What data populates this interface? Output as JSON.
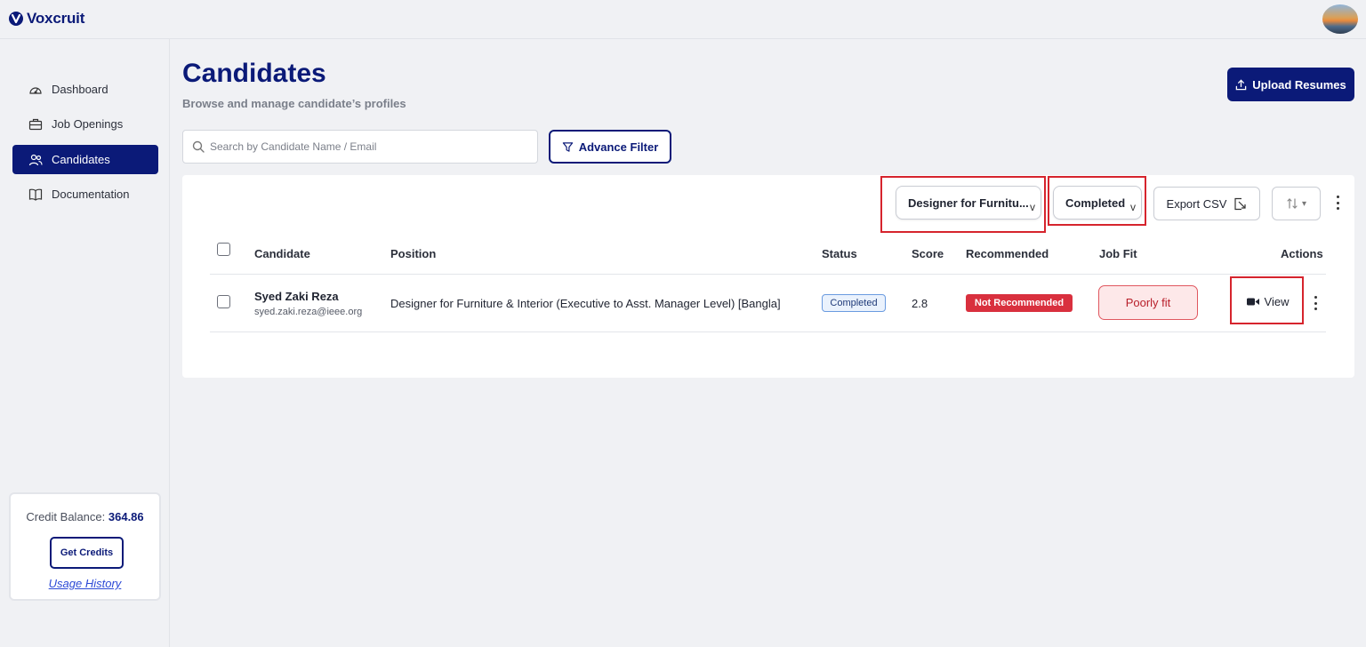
{
  "brand": {
    "name": "Voxcruit"
  },
  "sidebar": {
    "items": [
      {
        "label": "Dashboard",
        "icon": "gauge-icon",
        "active": false
      },
      {
        "label": "Job Openings",
        "icon": "briefcase-icon",
        "active": false
      },
      {
        "label": "Candidates",
        "icon": "users-icon",
        "active": true
      },
      {
        "label": "Documentation",
        "icon": "book-icon",
        "active": false
      }
    ],
    "credits": {
      "label": "Credit Balance:",
      "value": "364.86",
      "button": "Get Credits",
      "link": "Usage History"
    }
  },
  "header": {
    "title": "Candidates",
    "subtitle": "Browse and manage candidate’s profiles",
    "upload_label": "Upload Resumes"
  },
  "search": {
    "placeholder": "Search by Candidate Name / Email",
    "value": ""
  },
  "filter": {
    "label": "Advance Filter"
  },
  "toolbar": {
    "position_filter": "Designer for Furnitu...",
    "status_filter": "Completed",
    "export_label": "Export CSV"
  },
  "table": {
    "columns": [
      "Candidate",
      "Position",
      "Status",
      "Score",
      "Recommended",
      "Job Fit",
      "Actions"
    ],
    "rows": [
      {
        "name": "Syed Zaki Reza",
        "email": "syed.zaki.reza@ieee.org",
        "position": "Designer for Furniture & Interior (Executive to Asst. Manager Level) [Bangla]",
        "status": "Completed",
        "score": "2.8",
        "recommended": "Not Recommended",
        "job_fit": "Poorly fit",
        "action": "View"
      }
    ]
  },
  "colors": {
    "brand": "#0b1a78",
    "danger": "#d9303e",
    "highlight_box": "#d6242d",
    "background": "#f0f1f4"
  }
}
